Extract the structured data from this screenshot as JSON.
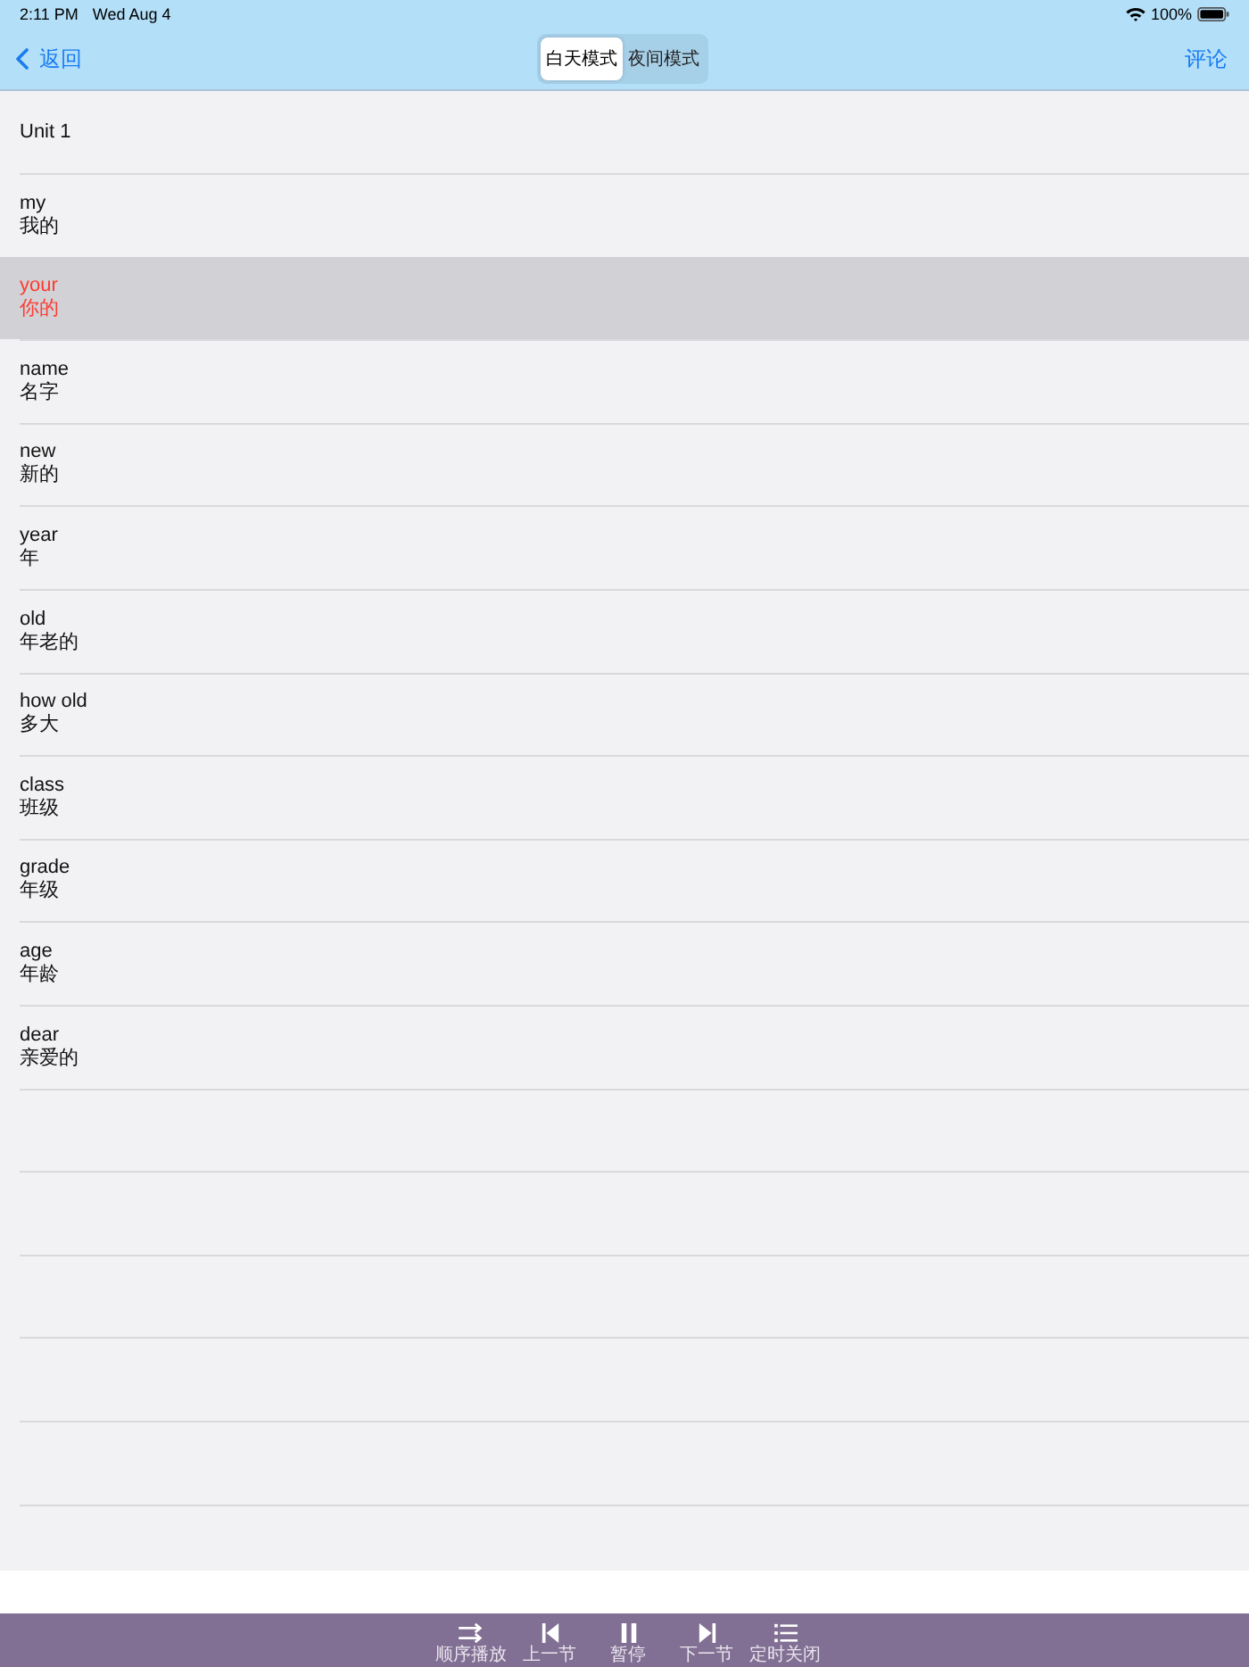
{
  "status_bar": {
    "time": "2:11 PM",
    "date": "Wed Aug 4",
    "battery": "100%"
  },
  "nav_bar": {
    "back": "返回",
    "segments": [
      {
        "label": "白天模式",
        "selected": true
      },
      {
        "label": "夜间模式",
        "selected": false
      }
    ],
    "action": "评论"
  },
  "list": {
    "header": "Unit 1",
    "items": [
      {
        "word": "my",
        "meaning": "我的",
        "selected": false
      },
      {
        "word": "your",
        "meaning": "你的",
        "selected": true
      },
      {
        "word": "name",
        "meaning": "名字",
        "selected": false
      },
      {
        "word": "new",
        "meaning": "新的",
        "selected": false
      },
      {
        "word": "year",
        "meaning": "年",
        "selected": false
      },
      {
        "word": "old",
        "meaning": "年老的",
        "selected": false
      },
      {
        "word": "how old",
        "meaning": "多大",
        "selected": false
      },
      {
        "word": "class",
        "meaning": "班级",
        "selected": false
      },
      {
        "word": "grade",
        "meaning": "年级",
        "selected": false
      },
      {
        "word": "age",
        "meaning": "年龄",
        "selected": false
      },
      {
        "word": "dear",
        "meaning": "亲爱的",
        "selected": false
      }
    ]
  },
  "toolbar": {
    "buttons": [
      {
        "kind": "order",
        "label": "顺序播放"
      },
      {
        "kind": "previous",
        "label": "上一节"
      },
      {
        "kind": "pause",
        "label": "暂停"
      },
      {
        "kind": "next",
        "label": "下一节"
      },
      {
        "kind": "list",
        "label": "定时关闭"
      }
    ]
  }
}
